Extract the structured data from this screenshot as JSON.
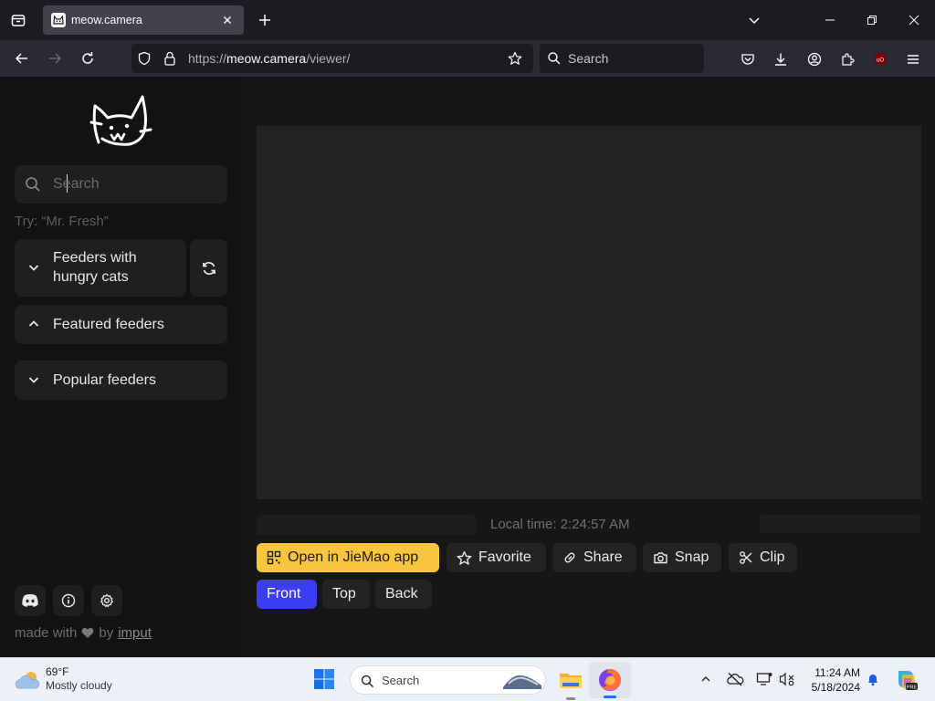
{
  "browser": {
    "tab": {
      "title": "meow.camera",
      "favicon": "cat-favicon-icon"
    },
    "url": {
      "prefix": "https://",
      "host": "meow.camera",
      "path": "/viewer/"
    },
    "search_placeholder": "Search"
  },
  "sidebar": {
    "search_placeholder": "Search",
    "hint": "Try: “Mr. Fresh”",
    "sections": [
      {
        "label": "Feeders with hungry cats",
        "expanded": false
      },
      {
        "label": "Featured feeders",
        "expanded": true
      },
      {
        "label": "Popular feeders",
        "expanded": false
      }
    ],
    "footer": {
      "made_with": "made with",
      "by": "by",
      "link": "imput"
    }
  },
  "viewer": {
    "local_time": "Local time: 2:24:57 AM",
    "actions": {
      "open_app": "Open in JieMao app",
      "favorite": "Favorite",
      "share": "Share",
      "snap": "Snap",
      "clip": "Clip"
    },
    "cameras": {
      "front": "Front",
      "top": "Top",
      "back": "Back",
      "active": "Front"
    }
  },
  "taskbar": {
    "weather_temp": "69°F",
    "weather_desc": "Mostly cloudy",
    "search_placeholder": "Search",
    "time": "11:24 AM",
    "date": "5/18/2024"
  },
  "colors": {
    "accent_yellow": "#f9c53c",
    "accent_blue": "#3c3df2",
    "browser_tab_active": "#42414d"
  }
}
